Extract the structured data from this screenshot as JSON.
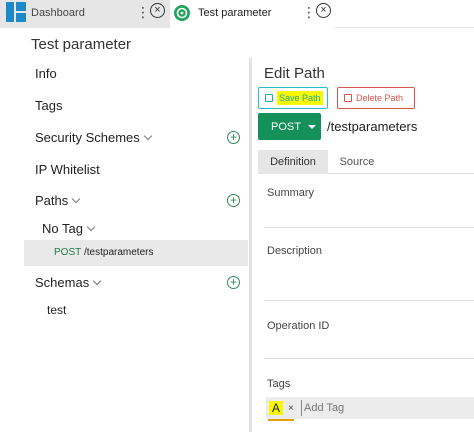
{
  "tabs": [
    {
      "label": "Dashboard"
    },
    {
      "label": "Test parameter"
    }
  ],
  "page": {
    "title": "Test parameter"
  },
  "sidebar": {
    "items": [
      {
        "label": "Info"
      },
      {
        "label": "Tags"
      },
      {
        "label": "Security Schemes"
      },
      {
        "label": "IP Whitelist"
      },
      {
        "label": "Paths"
      },
      {
        "label": "No Tag"
      },
      {
        "label": "Schemas"
      },
      {
        "label": "test"
      }
    ],
    "path": {
      "method": "POST",
      "name": "/testparameters"
    }
  },
  "main": {
    "title": "Edit Path",
    "save_label": "Save Path",
    "delete_label": "Delete Path",
    "method": "POST",
    "path": "/testparameters",
    "tabs": [
      {
        "label": "Definition"
      },
      {
        "label": "Source"
      }
    ],
    "fields": {
      "summary": "Summary",
      "description": "Description",
      "operation_id": "Operation ID",
      "tags": "Tags"
    },
    "tag_chip": "A",
    "tag_remove": "×",
    "tag_placeholder": "Add Tag"
  },
  "colors": {
    "accent": "#16905b",
    "highlight": "#f7f700",
    "danger": "#d9534f",
    "save": "#25c0c8"
  }
}
